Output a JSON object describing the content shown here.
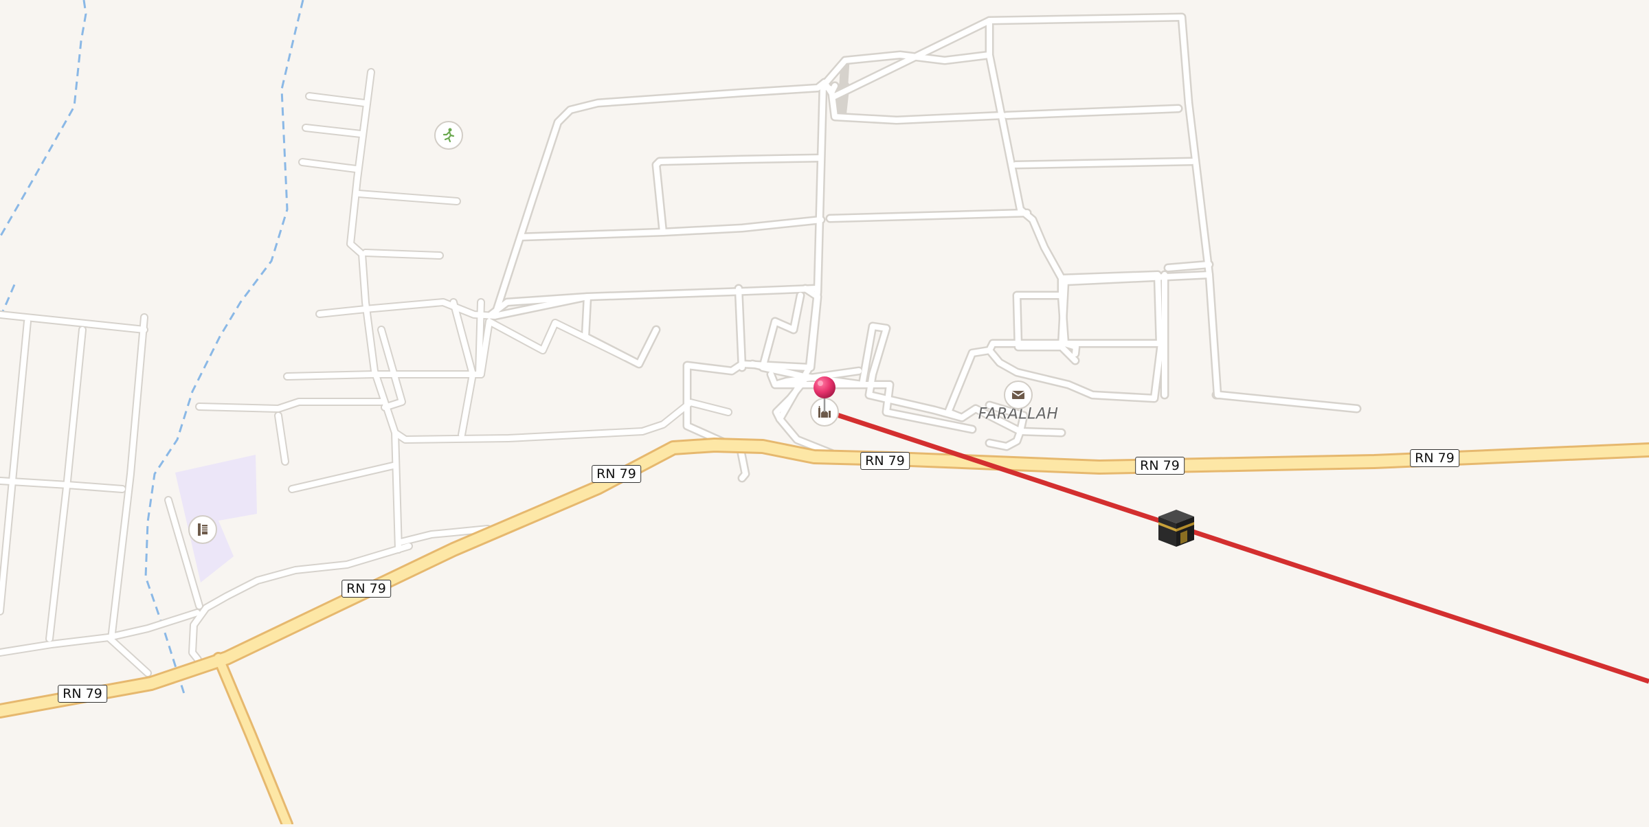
{
  "map": {
    "place_name": "FARALLAH",
    "road_labels": [
      "RN 79",
      "RN 79",
      "RN 79",
      "RN 79",
      "RN 79",
      "RN 79"
    ],
    "pois": [
      {
        "name": "sports-icon",
        "color": "#6aa84f"
      },
      {
        "name": "mosque-icon",
        "color": "#6d5a4a"
      },
      {
        "name": "post-office-icon",
        "color": "#6d5a4a"
      },
      {
        "name": "school-icon",
        "color": "#6d5a4a"
      }
    ],
    "location_pin": {
      "icon": "location-pin-icon",
      "color": "#e8336d"
    },
    "qibla": {
      "icon": "kaaba-icon",
      "line_color": "#d32f2f"
    },
    "colors": {
      "background": "#f8f5f1",
      "primary_road": "#fde7a6",
      "primary_road_casing": "#e6b86e",
      "minor_road": "#ffffff",
      "minor_road_casing": "#d6d2cc",
      "waterway": "#8ab8e6",
      "landuse": "#ece6f8"
    }
  }
}
